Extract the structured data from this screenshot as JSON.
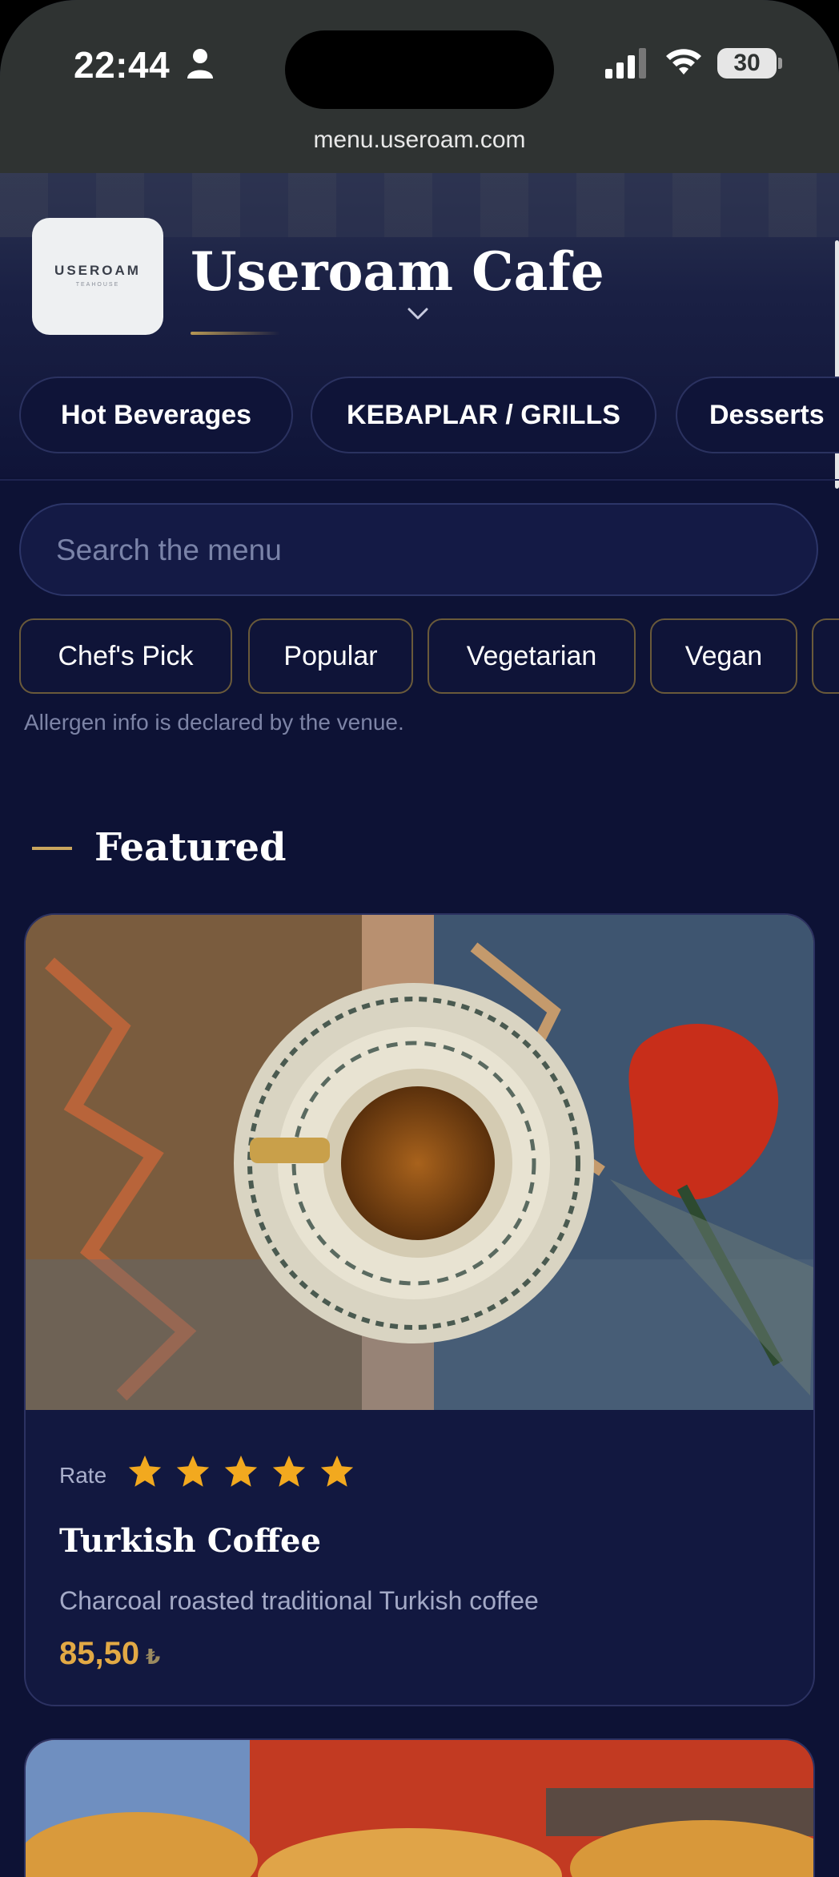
{
  "status_bar": {
    "time": "22:44",
    "battery": "30"
  },
  "browser": {
    "url": "menu.useroam.com"
  },
  "header": {
    "logo_text": "USEROAM",
    "logo_sub": "TEAHOUSE",
    "title": "Useroam Cafe"
  },
  "categories": [
    {
      "label": "Hot Beverages"
    },
    {
      "label": "KEBAPLAR / GRILLS"
    },
    {
      "label": "Desserts"
    }
  ],
  "search": {
    "placeholder": "Search the menu"
  },
  "filters": [
    {
      "label": "Chef's Pick"
    },
    {
      "label": "Popular"
    },
    {
      "label": "Vegetarian"
    },
    {
      "label": "Vegan"
    }
  ],
  "allergen_note": "Allergen info is declared by the venue.",
  "featured": {
    "heading": "Featured",
    "items": [
      {
        "rate_label": "Rate",
        "rating": 5,
        "name": "Turkish Coffee",
        "description": "Charcoal roasted traditional Turkish coffee",
        "price": "85,50",
        "currency": "₺"
      }
    ]
  },
  "colors": {
    "background": "#0d1235",
    "accent_gold": "#e2a945",
    "star": "#f2a91f"
  }
}
